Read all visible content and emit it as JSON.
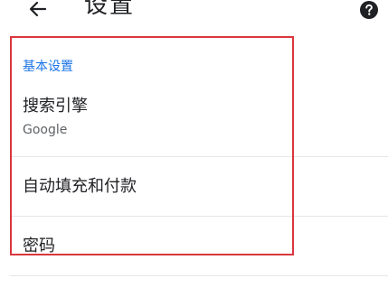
{
  "header": {
    "back_icon": "arrow-left-icon",
    "title": "设置",
    "help_icon": "help-circle-icon"
  },
  "section": {
    "label": "基本设置"
  },
  "items": [
    {
      "title": "搜索引擎",
      "subtitle": "Google"
    },
    {
      "title": "自动填充和付款"
    },
    {
      "title": "密码"
    }
  ],
  "colors": {
    "accent": "#1a73e8",
    "highlight": "#d9363e",
    "text": "#202124",
    "secondary_text": "#5f6368"
  }
}
